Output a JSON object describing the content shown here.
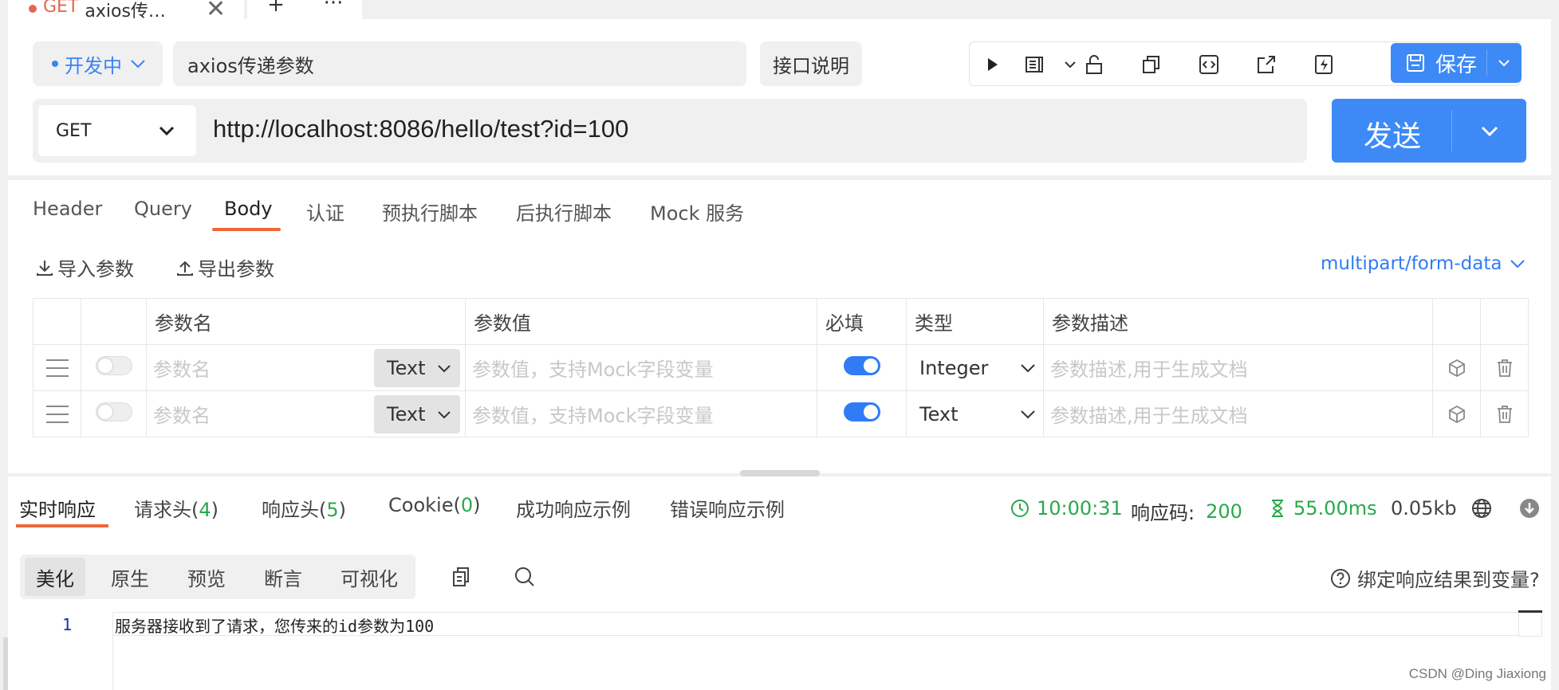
{
  "tab": {
    "method": "GET",
    "name": "axios传…",
    "close": "✕",
    "add": "+",
    "more": "···"
  },
  "toolbar": {
    "status": "开发中",
    "api_name": "axios传递参数",
    "desc_button": "接口说明",
    "save_label": "保存"
  },
  "request": {
    "method": "GET",
    "url": "http://localhost:8086/hello/test?id=100",
    "send_label": "发送"
  },
  "req_tabs": [
    "Header",
    "Query",
    "Body",
    "认证",
    "预执行脚本",
    "后执行脚本",
    "Mock 服务"
  ],
  "actions": {
    "import": "导入参数",
    "export": "导出参数",
    "content_type": "multipart/form-data"
  },
  "table": {
    "headers": [
      "参数名",
      "参数值",
      "必填",
      "类型",
      "参数描述"
    ],
    "rows": [
      {
        "name_placeholder": "参数名",
        "value_type": "Text",
        "value_placeholder": "参数值，支持Mock字段变量",
        "required": true,
        "type": "Integer",
        "desc_placeholder": "参数描述,用于生成文档"
      },
      {
        "name_placeholder": "参数名",
        "value_type": "Text",
        "value_placeholder": "参数值，支持Mock字段变量",
        "required": true,
        "type": "Text",
        "desc_placeholder": "参数描述,用于生成文档"
      }
    ]
  },
  "response": {
    "tabs": {
      "realtime": "实时响应",
      "req_headers": "请求头(",
      "req_headers_count": "4",
      "resp_headers": "响应头(",
      "resp_headers_count": "5",
      "cookie": "Cookie(",
      "cookie_count": "0",
      "close_paren": ")",
      "success_example": "成功响应示例",
      "error_example": "错误响应示例"
    },
    "time": "10:00:31",
    "code_label": "响应码:",
    "code": "200",
    "duration": "55.00ms",
    "size": "0.05kb",
    "views": [
      "美化",
      "原生",
      "预览",
      "断言",
      "可视化"
    ],
    "bind_label": "绑定响应结果到变量?",
    "line_number": "1",
    "body": "服务器接收到了请求，您传来的id参数为100"
  },
  "watermark": "CSDN @Ding Jiaxiong",
  "colors": {
    "accent": "#3d8af7",
    "active_tab": "#f0663a",
    "success": "#2aa84a",
    "method_get": "#e86452"
  }
}
